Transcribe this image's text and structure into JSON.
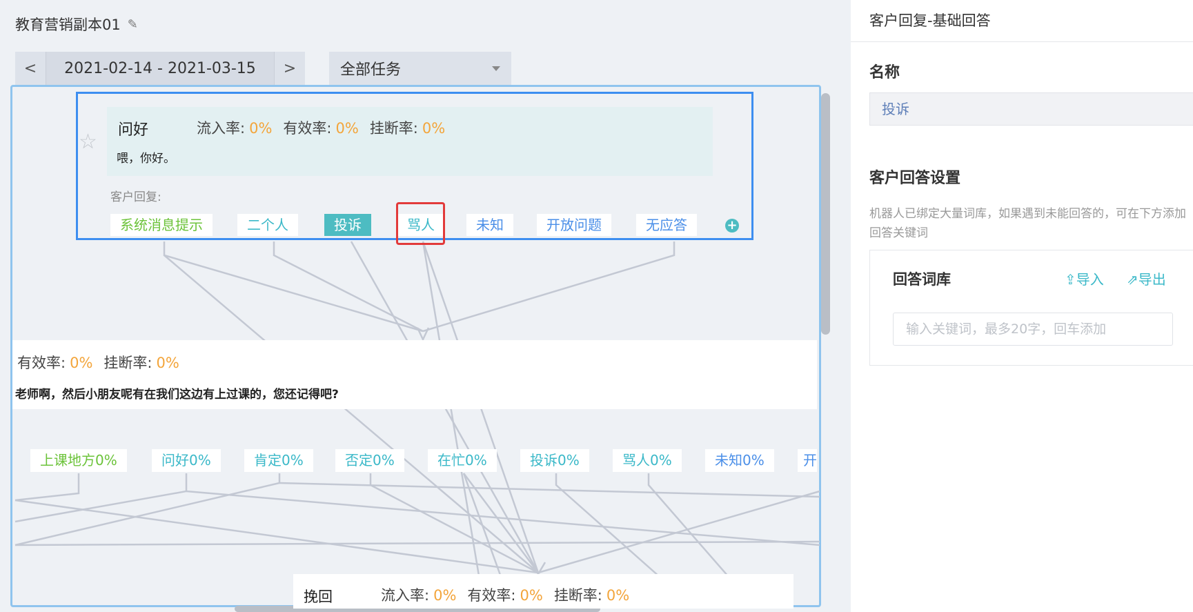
{
  "editor": {
    "title": "教育营销副本01",
    "date_range": "2021-02-14 - 2021-03-15",
    "prev_symbol": "<",
    "next_symbol": ">",
    "task_filter": "全部任务"
  },
  "metric_labels": {
    "inflow": "流入率:",
    "effective": "有效率:",
    "hangup": "挂断率:"
  },
  "node1": {
    "name": "问好",
    "inflow": "0%",
    "effective": "0%",
    "hangup": "0%",
    "speech": "喂，你好。",
    "reply_label": "客户回复:",
    "replies": [
      "系统消息提示",
      "二个人",
      "投诉",
      "骂人",
      "未知",
      "开放问题",
      "无应答"
    ],
    "active_reply": "投诉"
  },
  "node2": {
    "effective": "0%",
    "hangup": "0%",
    "speech": "老师啊，然后小朋友呢有在我们这边有上过课的，您还记得吧?",
    "replies": [
      "上课地方0%",
      "问好0%",
      "肯定0%",
      "否定0%",
      "在忙0%",
      "投诉0%",
      "骂人0%",
      "未知0%",
      "开"
    ]
  },
  "node3": {
    "name": "挽回",
    "inflow": "0%",
    "effective": "0%",
    "hangup": "0%"
  },
  "panel": {
    "title": "客户回复-基础回答",
    "name_label": "名称",
    "name_value": "投诉",
    "setting_label": "客户回答设置",
    "setting_desc": "机器人已绑定大量词库，如果遇到未能回答的，可在下方添加回答关键词",
    "library_title": "回答词库",
    "import_label": "导入",
    "export_label": "导出",
    "keyword_placeholder": "输入关键词，最多20字，回车添加"
  },
  "colors": {
    "accent_teal": "#4dbcc2",
    "metric_orange": "#f3a53b",
    "selection_blue": "#3d8ef0",
    "highlight_red": "#e23a3a"
  },
  "icons": [
    "edit-icon",
    "chevron-left-icon",
    "chevron-right-icon",
    "caret-down-icon",
    "star-icon",
    "add-icon",
    "import-icon",
    "export-icon"
  ]
}
